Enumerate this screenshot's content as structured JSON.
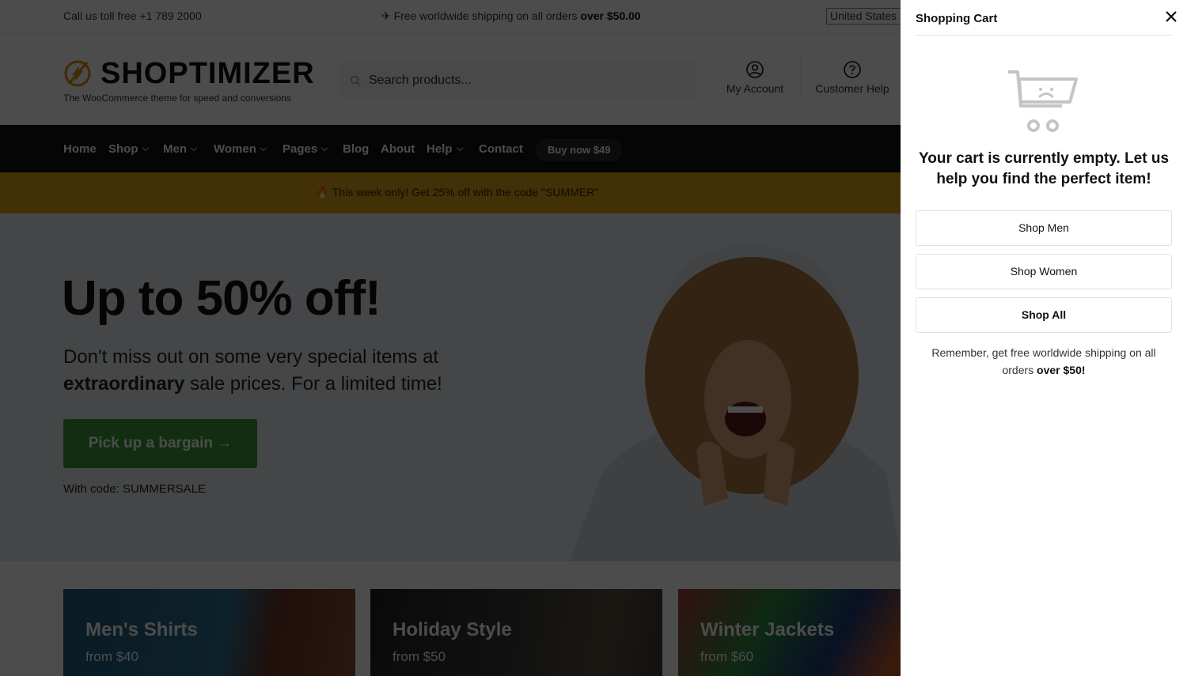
{
  "topbar": {
    "call": "Call us toll free +1 789 2000",
    "shipping_prefix": "✈ Free worldwide shipping on all orders ",
    "shipping_bold": "over $50.00",
    "country": "United States"
  },
  "header": {
    "logo_word": "SHOPTIMIZER",
    "logo_tagline": "The WooCommerce theme for speed and conversions",
    "search_placeholder": "Search products...",
    "account_label": "My Account",
    "help_label": "Customer Help"
  },
  "nav": {
    "items": [
      {
        "label": "Home",
        "dropdown": false
      },
      {
        "label": "Shop",
        "dropdown": true
      },
      {
        "label": "Men",
        "dropdown": true
      },
      {
        "label": "Women",
        "dropdown": true
      },
      {
        "label": "Pages",
        "dropdown": true
      },
      {
        "label": "Blog",
        "dropdown": false
      },
      {
        "label": "About",
        "dropdown": false
      },
      {
        "label": "Help",
        "dropdown": true
      },
      {
        "label": "Contact",
        "dropdown": false
      }
    ],
    "buy_label": "Buy now $49"
  },
  "promo": {
    "text": "🔥 This week only! Get 25% off with the code \"SUMMER\""
  },
  "hero": {
    "heading": "Up to 50% off!",
    "text_line1": "Don't miss out on some very special items at",
    "text_bold": "extraordinary",
    "text_line2": " sale prices. For a limited time!",
    "cta_label": "Pick up a bargain →",
    "code_text": "With code: SUMMERSALE"
  },
  "categories": [
    {
      "title": "Men's Shirts",
      "price": "from $40"
    },
    {
      "title": "Holiday Style",
      "price": "from $50"
    },
    {
      "title": "Winter Jackets",
      "price": "from $60"
    }
  ],
  "cart": {
    "title": "Shopping Cart",
    "empty_message": "Your cart is currently empty. Let us help you find the perfect item!",
    "buttons": [
      "Shop Men",
      "Shop Women",
      "Shop All"
    ],
    "note_prefix": "Remember, get free worldwide shipping on all orders ",
    "note_bold": "over $50!"
  },
  "colors": {
    "accent_orange": "#dca016",
    "cta_green": "#3a9b3a",
    "nav_bg": "#111111",
    "overlay": "rgba(0,0,0,0.7)"
  }
}
